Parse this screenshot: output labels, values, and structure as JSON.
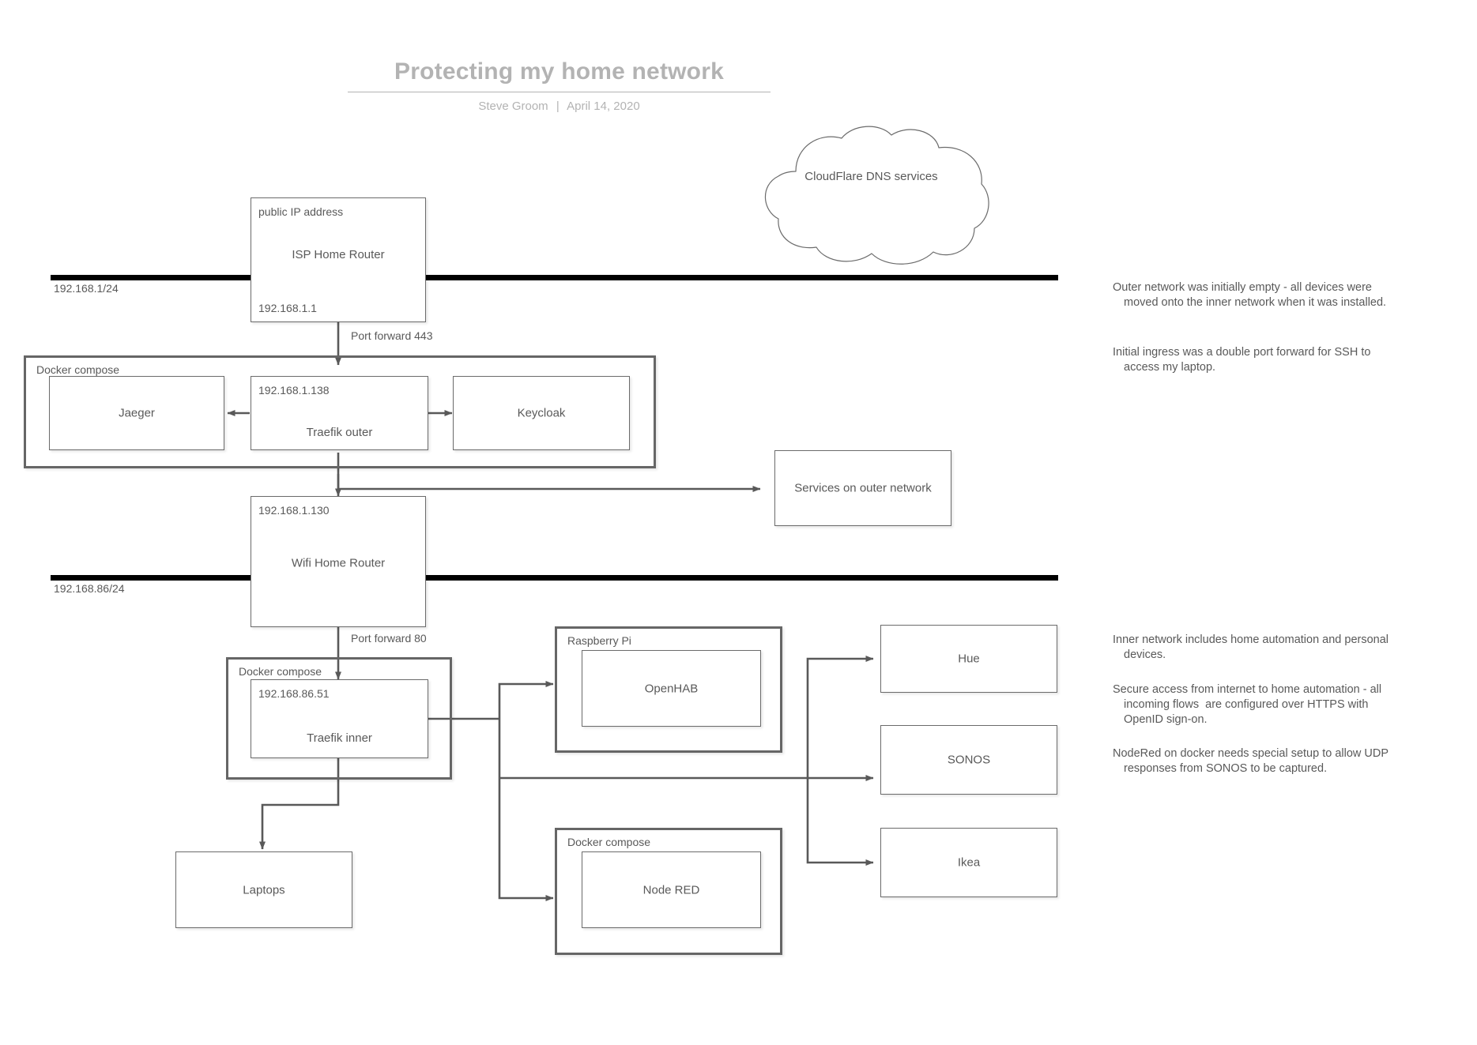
{
  "title": {
    "heading": "Protecting my home network",
    "author": "Steve Groom",
    "separator": "|",
    "date": "April 14, 2020"
  },
  "networks": [
    {
      "id": "outer",
      "label": "192.168.1/24"
    },
    {
      "id": "inner",
      "label": "192.168.86/24"
    }
  ],
  "cloud": {
    "label": "CloudFlare DNS  services"
  },
  "nodes": {
    "isp_router": {
      "top_label": "public IP address",
      "name": "ISP Home Router",
      "ip": "192.168.1.1"
    },
    "wifi_router": {
      "ip": "192.168.1.130",
      "name": "Wifi Home Router"
    },
    "jaeger": {
      "name": "Jaeger"
    },
    "traefik_outer": {
      "ip": "192.168.1.138",
      "name": "Traefik outer"
    },
    "keycloak": {
      "name": "Keycloak"
    },
    "services_outer": {
      "name": "Services on outer network"
    },
    "traefik_inner": {
      "ip": "192.168.86.51",
      "name": "Traefik inner"
    },
    "openhab": {
      "name": "OpenHAB"
    },
    "node_red": {
      "name": "Node RED"
    },
    "laptops": {
      "name": "Laptops"
    },
    "hue": {
      "name": "Hue"
    },
    "sonos": {
      "name": "SONOS"
    },
    "ikea": {
      "name": "Ikea"
    }
  },
  "groups": {
    "docker_outer": {
      "label": "Docker compose"
    },
    "docker_inner": {
      "label": "Docker compose"
    },
    "raspberry_pi": {
      "label": "Raspberry Pi"
    },
    "docker_nodered": {
      "label": "Docker compose"
    }
  },
  "edges": {
    "port_forward_443": {
      "label": "Port forward 443"
    },
    "port_forward_80": {
      "label": "Port forward 80"
    }
  },
  "notes": [
    {
      "id": "note-outer-empty",
      "text": "Outer network was initially empty - all devices were moved onto the inner network when it was installed."
    },
    {
      "id": "note-initial-ingress",
      "text": "Initial ingress was a double port forward for SSH to access my laptop."
    },
    {
      "id": "note-inner-network",
      "text": "Inner network includes home automation and personal devices."
    },
    {
      "id": "note-secure-access",
      "text": "Secure access from internet to home automation - all incoming flows  are configured over HTTPS with OpenID sign-on."
    },
    {
      "id": "note-nodered-udp",
      "text": "NodeRed on docker needs special setup to allow UDP responses from SONOS to be captured."
    }
  ],
  "colors": {
    "title": "#b3b3b3",
    "text": "#595959",
    "node_border": "#6b6b6b",
    "group_border": "#666666",
    "bus": "#000000",
    "wire": "#595959"
  }
}
